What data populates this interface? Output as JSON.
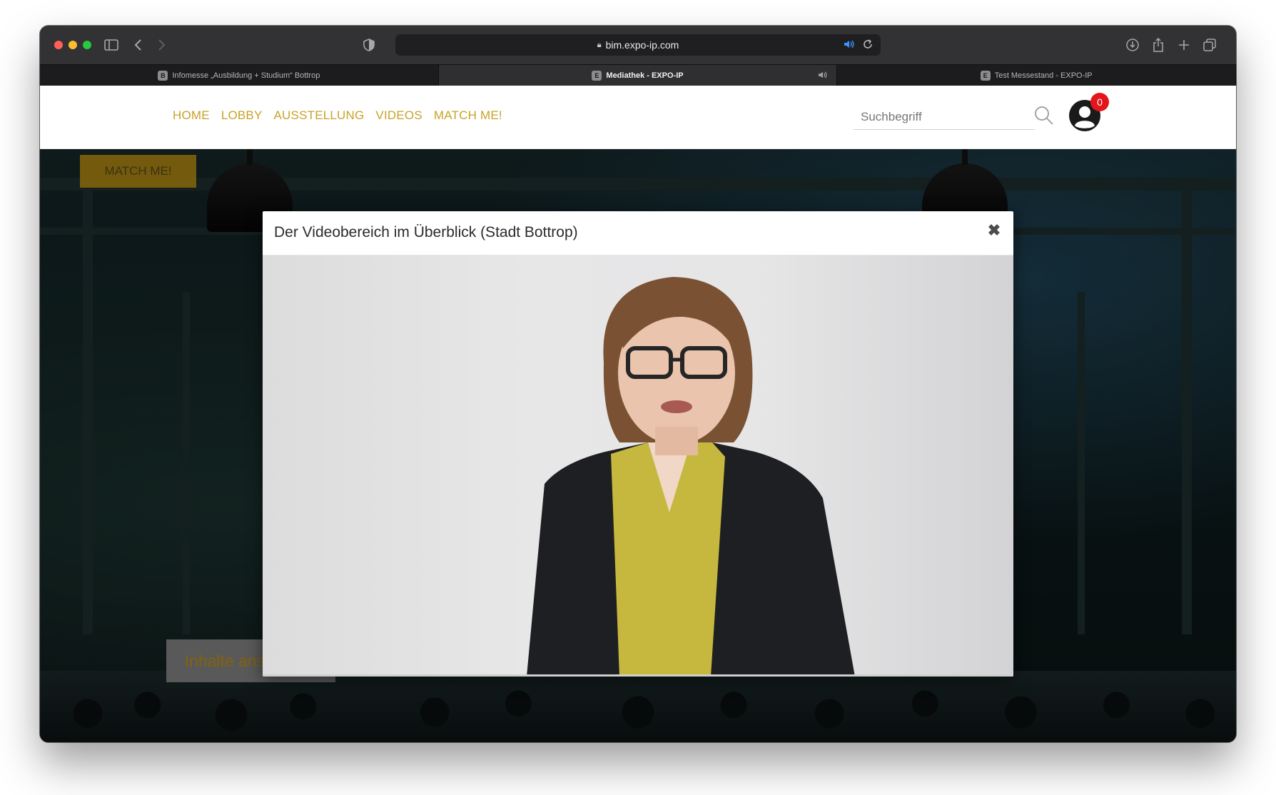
{
  "browser": {
    "url": "bim.expo-ip.com",
    "tabs": [
      {
        "label": "Infomesse „Ausbildung + Studium“ Bottrop",
        "favicon": "B",
        "active": false,
        "audio": false
      },
      {
        "label": "Mediathek - EXPO-IP",
        "favicon": "E",
        "active": true,
        "audio": true
      },
      {
        "label": "Test Messestand - EXPO-IP",
        "favicon": "E",
        "active": false,
        "audio": false
      }
    ]
  },
  "site": {
    "nav": [
      "HOME",
      "LOBBY",
      "AUSSTELLUNG",
      "VIDEOS",
      "MATCH ME!"
    ],
    "search": {
      "placeholder": "Suchbegriff"
    },
    "notification_count": "0",
    "match_button": "MATCH ME!",
    "inhalte_button": "Inhalte ansehen",
    "accent_color": "#c9a227"
  },
  "modal": {
    "title": "Der Videobereich im Überblick (Stadt Bottrop)",
    "close_symbol": "✖"
  },
  "icons": {
    "close": "close-icon",
    "search": "search-icon",
    "user": "user-icon",
    "chevron": "chevron-down-icon"
  }
}
